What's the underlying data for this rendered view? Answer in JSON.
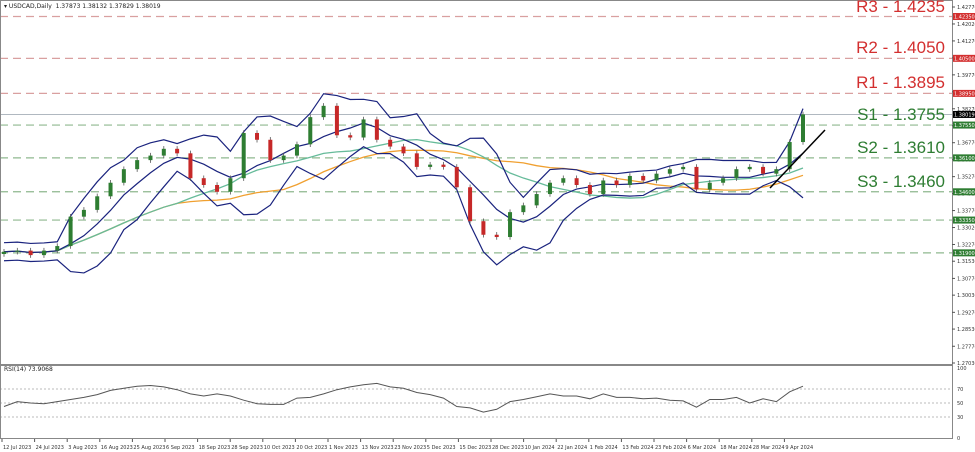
{
  "header": {
    "symbol": "USDCAD,Daily",
    "ohlc": "1.37873 1.38132 1.37829 1.38019"
  },
  "rsi_header": "RSI(14) 73.9068",
  "colors": {
    "bull": "#2e7d32",
    "bear": "#c62828",
    "bands": "#1a237e",
    "ma_fast": "#66bb9a",
    "ma_slow": "#f0a030",
    "resistance": "#d32f2f",
    "support": "#2e7d32"
  },
  "levels": [
    {
      "label": "R3 - 1.4235",
      "price": 1.4235,
      "tag": "1.42350",
      "kind": "resistance"
    },
    {
      "label": "R2 - 1.4050",
      "price": 1.405,
      "tag": "1.40500",
      "kind": "resistance"
    },
    {
      "label": "R1 - 1.3895",
      "price": 1.3895,
      "tag": "1.38950",
      "kind": "resistance"
    },
    {
      "label": "S1 - 1.3755",
      "price": 1.3755,
      "tag": "1.37550",
      "kind": "support"
    },
    {
      "label": "S2 - 1.3610",
      "price": 1.361,
      "tag": "1.36100",
      "kind": "support"
    },
    {
      "label": "S3 - 1.3460",
      "price": 1.346,
      "tag": "1.34600",
      "kind": "support"
    },
    {
      "label": "",
      "price": 1.3335,
      "tag": "1.33350",
      "kind": "support"
    },
    {
      "label": "",
      "price": 1.319,
      "tag": "1.31900",
      "kind": "support"
    }
  ],
  "chart_data": {
    "type": "candlestick",
    "current_price": 1.38019,
    "current_price_tag": "1.38019",
    "ylim": [
      1.2703,
      1.4277
    ],
    "y_ticks": [
      "1.42770",
      "1.42020",
      "1.41270",
      "1.40520",
      "1.39770",
      "1.39020",
      "1.38270",
      "1.37520",
      "1.36770",
      "1.36020",
      "1.35270",
      "1.34520",
      "1.33770",
      "1.33020",
      "1.32270",
      "1.31530",
      "1.30770",
      "1.30030",
      "1.29270",
      "1.28530",
      "1.27770",
      "1.27030"
    ],
    "x_ticks": [
      "12 Jul 2023",
      "24 Jul 2023",
      "3 Aug 2023",
      "16 Aug 2023",
      "25 Aug 2023",
      "6 Sep 2023",
      "18 Sep 2023",
      "28 Sep 2023",
      "10 Oct 2023",
      "20 Oct 2023",
      "1 Nov 2023",
      "13 Nov 2023",
      "23 Nov 2023",
      "5 Dec 2023",
      "15 Dec 2023",
      "28 Dec 2023",
      "10 Jan 2024",
      "22 Jan 2024",
      "1 Feb 2024",
      "13 Feb 2024",
      "23 Feb 2024",
      "6 Mar 2024",
      "18 Mar 2024",
      "28 Mar 2024",
      "9 Apr 2024"
    ],
    "closes": [
      1.3195,
      1.32,
      1.318,
      1.32,
      1.322,
      1.335,
      1.338,
      1.344,
      1.35,
      1.356,
      1.36,
      1.362,
      1.365,
      1.363,
      1.352,
      1.349,
      1.346,
      1.352,
      1.372,
      1.369,
      1.36,
      1.362,
      1.367,
      1.379,
      1.384,
      1.371,
      1.37,
      1.378,
      1.369,
      1.366,
      1.363,
      1.357,
      1.358,
      1.357,
      1.348,
      1.333,
      1.327,
      1.326,
      1.337,
      1.34,
      1.345,
      1.35,
      1.352,
      1.349,
      1.345,
      1.351,
      1.349,
      1.353,
      1.351,
      1.354,
      1.356,
      1.357,
      1.347,
      1.35,
      1.352,
      1.356,
      1.357,
      1.354,
      1.356,
      1.368,
      1.3802
    ],
    "rsi": {
      "label": "RSI(14)",
      "last": 73.9068,
      "levels": [
        70,
        50,
        30
      ],
      "ylim": [
        0,
        100
      ],
      "y_ticks": [
        "100",
        "70",
        "50",
        "30",
        "0"
      ],
      "values": [
        45,
        52,
        50,
        49,
        52,
        55,
        58,
        62,
        68,
        71,
        74,
        75,
        73,
        69,
        63,
        60,
        63,
        60,
        54,
        49,
        48,
        48,
        57,
        58,
        63,
        69,
        73,
        76,
        78,
        73,
        71,
        65,
        62,
        57,
        45,
        43,
        37,
        41,
        52,
        55,
        59,
        63,
        60,
        60,
        56,
        63,
        58,
        58,
        56,
        57,
        54,
        53,
        44,
        55,
        55,
        58,
        50,
        56,
        52,
        66,
        74
      ]
    }
  }
}
